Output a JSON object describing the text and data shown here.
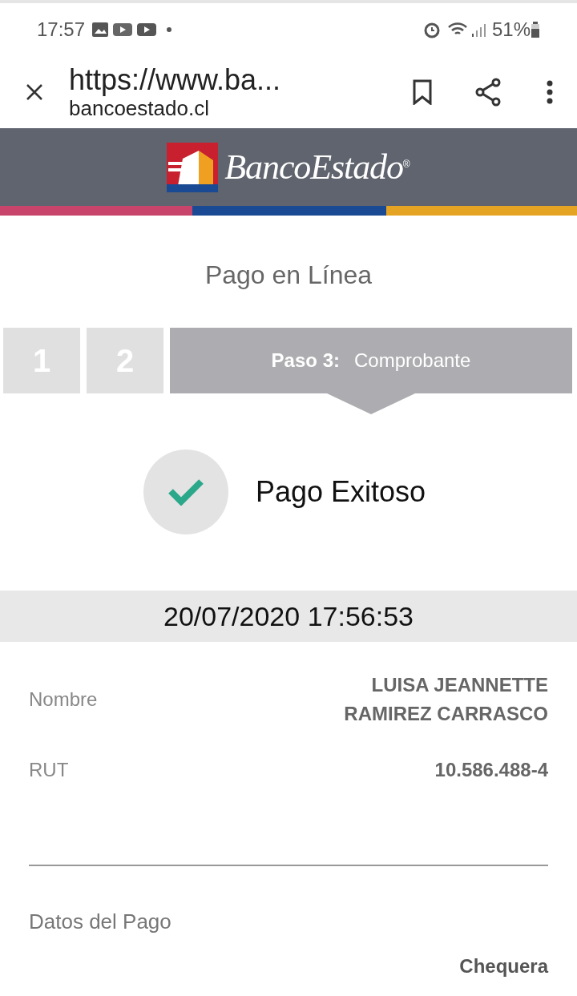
{
  "status_bar": {
    "time": "17:57",
    "battery": "51%"
  },
  "browser": {
    "url": "https://www.ba...",
    "domain": "bancoestado.cl"
  },
  "header": {
    "brand": "BancoEstado",
    "registered": "®"
  },
  "page_title": "Pago en Línea",
  "steps": [
    {
      "number": "1",
      "selected": false
    },
    {
      "number": "2",
      "selected": false
    },
    {
      "number": "Paso 3:",
      "label": "Comprobante",
      "selected": true
    }
  ],
  "result": {
    "message": "Pago Exitoso",
    "success": true
  },
  "timestamp": "20/07/2020 17:56:53",
  "fields": [
    {
      "label": "Nombre",
      "value": "LUISA JEANNETTE\nRAMIREZ CARRASCO"
    },
    {
      "label": "RUT",
      "value": "10.586.488-4"
    }
  ],
  "section_title": "Datos del Pago",
  "payment_method": "Chequera"
}
